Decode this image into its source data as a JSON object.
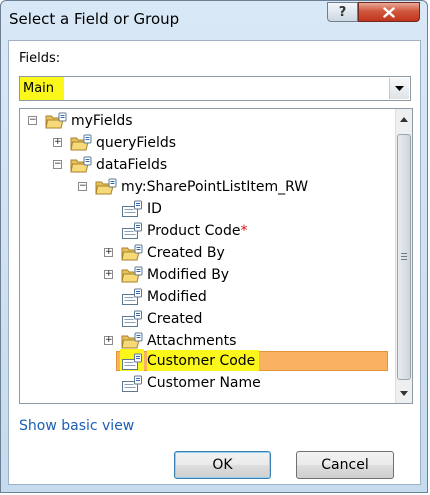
{
  "window": {
    "title": "Select a Field or Group",
    "help_glyph": "?",
    "close_icon": "close-icon"
  },
  "fields_label": "Fields:",
  "fields_combo": {
    "value": "Main",
    "highlight_color": "#fbf71b"
  },
  "tree": {
    "nodes": [
      {
        "label": "myFields",
        "expander": "−",
        "icon": "folder-icon"
      },
      {
        "label": "queryFields",
        "expander": "+",
        "icon": "folder-icon"
      },
      {
        "label": "dataFields",
        "expander": "−",
        "icon": "folder-icon"
      },
      {
        "label": "my:SharePointListItem_RW",
        "expander": "−",
        "icon": "folder-icon"
      },
      {
        "label": "ID",
        "icon": "field-icon"
      },
      {
        "label": "Product Code",
        "required_mark": "*",
        "icon": "field-icon"
      },
      {
        "label": "Created By",
        "expander": "+",
        "icon": "folder-icon"
      },
      {
        "label": "Modified By",
        "expander": "+",
        "icon": "folder-icon"
      },
      {
        "label": "Modified",
        "icon": "field-icon"
      },
      {
        "label": "Created",
        "icon": "field-icon"
      },
      {
        "label": "Attachments",
        "expander": "+",
        "icon": "folder-icon"
      },
      {
        "label": "Customer Code",
        "icon": "field-icon",
        "selected": true
      },
      {
        "label": "Customer Name",
        "icon": "field-icon"
      }
    ],
    "selection_color": "#f9b261"
  },
  "show_basic_view": "Show basic view",
  "buttons": {
    "ok": "OK",
    "cancel": "Cancel"
  }
}
